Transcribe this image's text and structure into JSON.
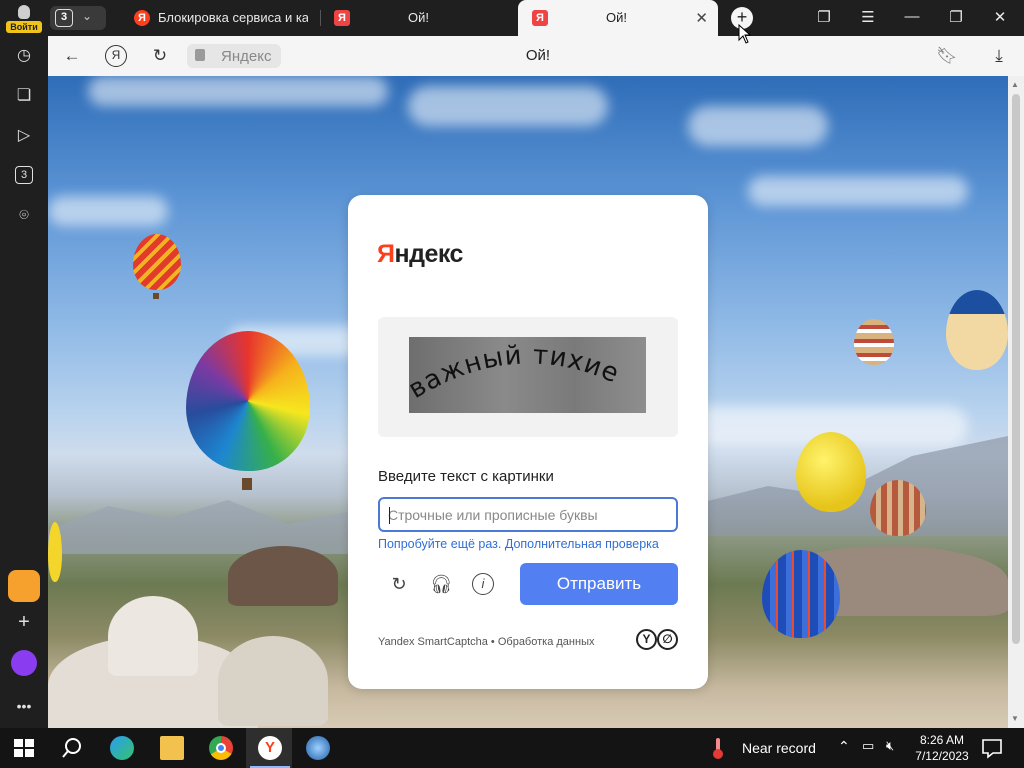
{
  "profile": {
    "badge": "Войти"
  },
  "tab_strip": {
    "tab_count": "3",
    "tabs": [
      {
        "title": "Блокировка сервиса и ка",
        "active": false
      },
      {
        "title": "Ой!",
        "active": false
      },
      {
        "title": "Ой!",
        "active": true
      }
    ]
  },
  "toolbar": {
    "address_chip": "Яндекс",
    "page_title": "Ой!"
  },
  "sidebar": {
    "items": [
      "history-icon",
      "collections-icon",
      "video-icon",
      "tabs-count-icon",
      "screenshot-icon"
    ],
    "tabs_badge": "3"
  },
  "captcha": {
    "logo_first": "Я",
    "logo_rest": "ндекс",
    "image_text": "важный тихие",
    "prompt": "Введите текст с картинки",
    "input_value": "",
    "input_placeholder": "Строчные или прописные буквы",
    "retry_link": "Попробуйте ещё раз.",
    "extra_link": "Дополнительная проверка",
    "submit_label": "Отправить",
    "footer_brand": "Yandex SmartCaptcha",
    "footer_separator": "•",
    "footer_link": "Обработка данных"
  },
  "taskbar": {
    "weather_text": "Near record",
    "time": "8:26 AM",
    "date": "7/12/2023"
  },
  "colors": {
    "accent": "#5280f2",
    "link": "#2f6fd6",
    "yandex_red": "#fc3f1d"
  }
}
